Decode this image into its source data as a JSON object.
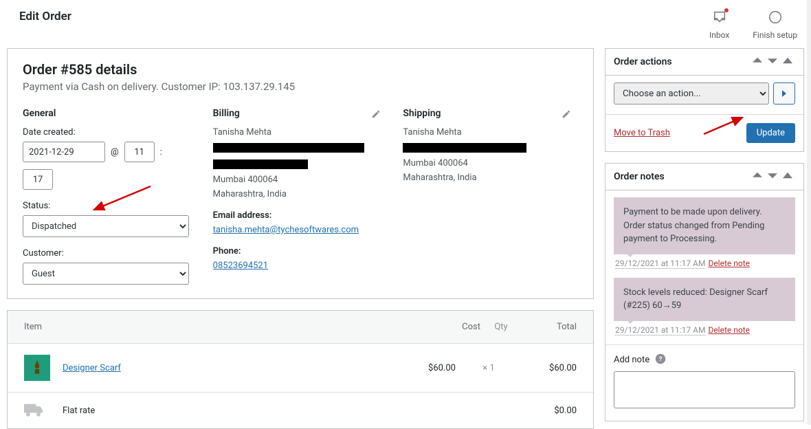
{
  "header": {
    "title": "Edit Order",
    "inbox_label": "Inbox",
    "finish_label": "Finish setup"
  },
  "order": {
    "title": "Order #585 details",
    "subtext": "Payment via Cash on delivery. Customer IP: 103.137.29.145"
  },
  "general": {
    "heading": "General",
    "date_label": "Date created:",
    "date": "2021-12-29",
    "at": "@",
    "hour": "11",
    "colon": ":",
    "minute": "17",
    "status_label": "Status:",
    "status_value": "Dispatched",
    "customer_label": "Customer:",
    "customer_value": "Guest"
  },
  "billing": {
    "heading": "Billing",
    "name": "Tanisha Mehta",
    "city": "Mumbai 400064",
    "state": "Maharashtra, India",
    "email_label": "Email address:",
    "email": "tanisha.mehta@tychesoftwares.com",
    "phone_label": "Phone:",
    "phone": "08523694521"
  },
  "shipping": {
    "heading": "Shipping",
    "name": "Tanisha Mehta",
    "city": "Mumbai 400064",
    "state": "Maharashtra, India"
  },
  "items": {
    "headers": {
      "item": "Item",
      "cost": "Cost",
      "qty": "Qty",
      "total": "Total"
    },
    "rows": [
      {
        "name": "Designer Scarf",
        "cost": "$60.00",
        "qty_prefix": "×",
        "qty": "1",
        "total": "$60.00"
      }
    ],
    "shipping_row": {
      "name": "Flat rate",
      "total": "$0.00"
    }
  },
  "actions": {
    "title": "Order actions",
    "choose": "Choose an action...",
    "trash": "Move to Trash",
    "update": "Update"
  },
  "notes": {
    "title": "Order notes",
    "items": [
      {
        "text": "Payment to be made upon delivery. Order status changed from Pending payment to Processing.",
        "meta": "29/12/2021 at 11:17 AM",
        "delete": "Delete note"
      },
      {
        "text": "Stock levels reduced: Designer Scarf (#225) 60→59",
        "meta": "29/12/2021 at 11:17 AM",
        "delete": "Delete note"
      }
    ],
    "add_label": "Add note"
  }
}
